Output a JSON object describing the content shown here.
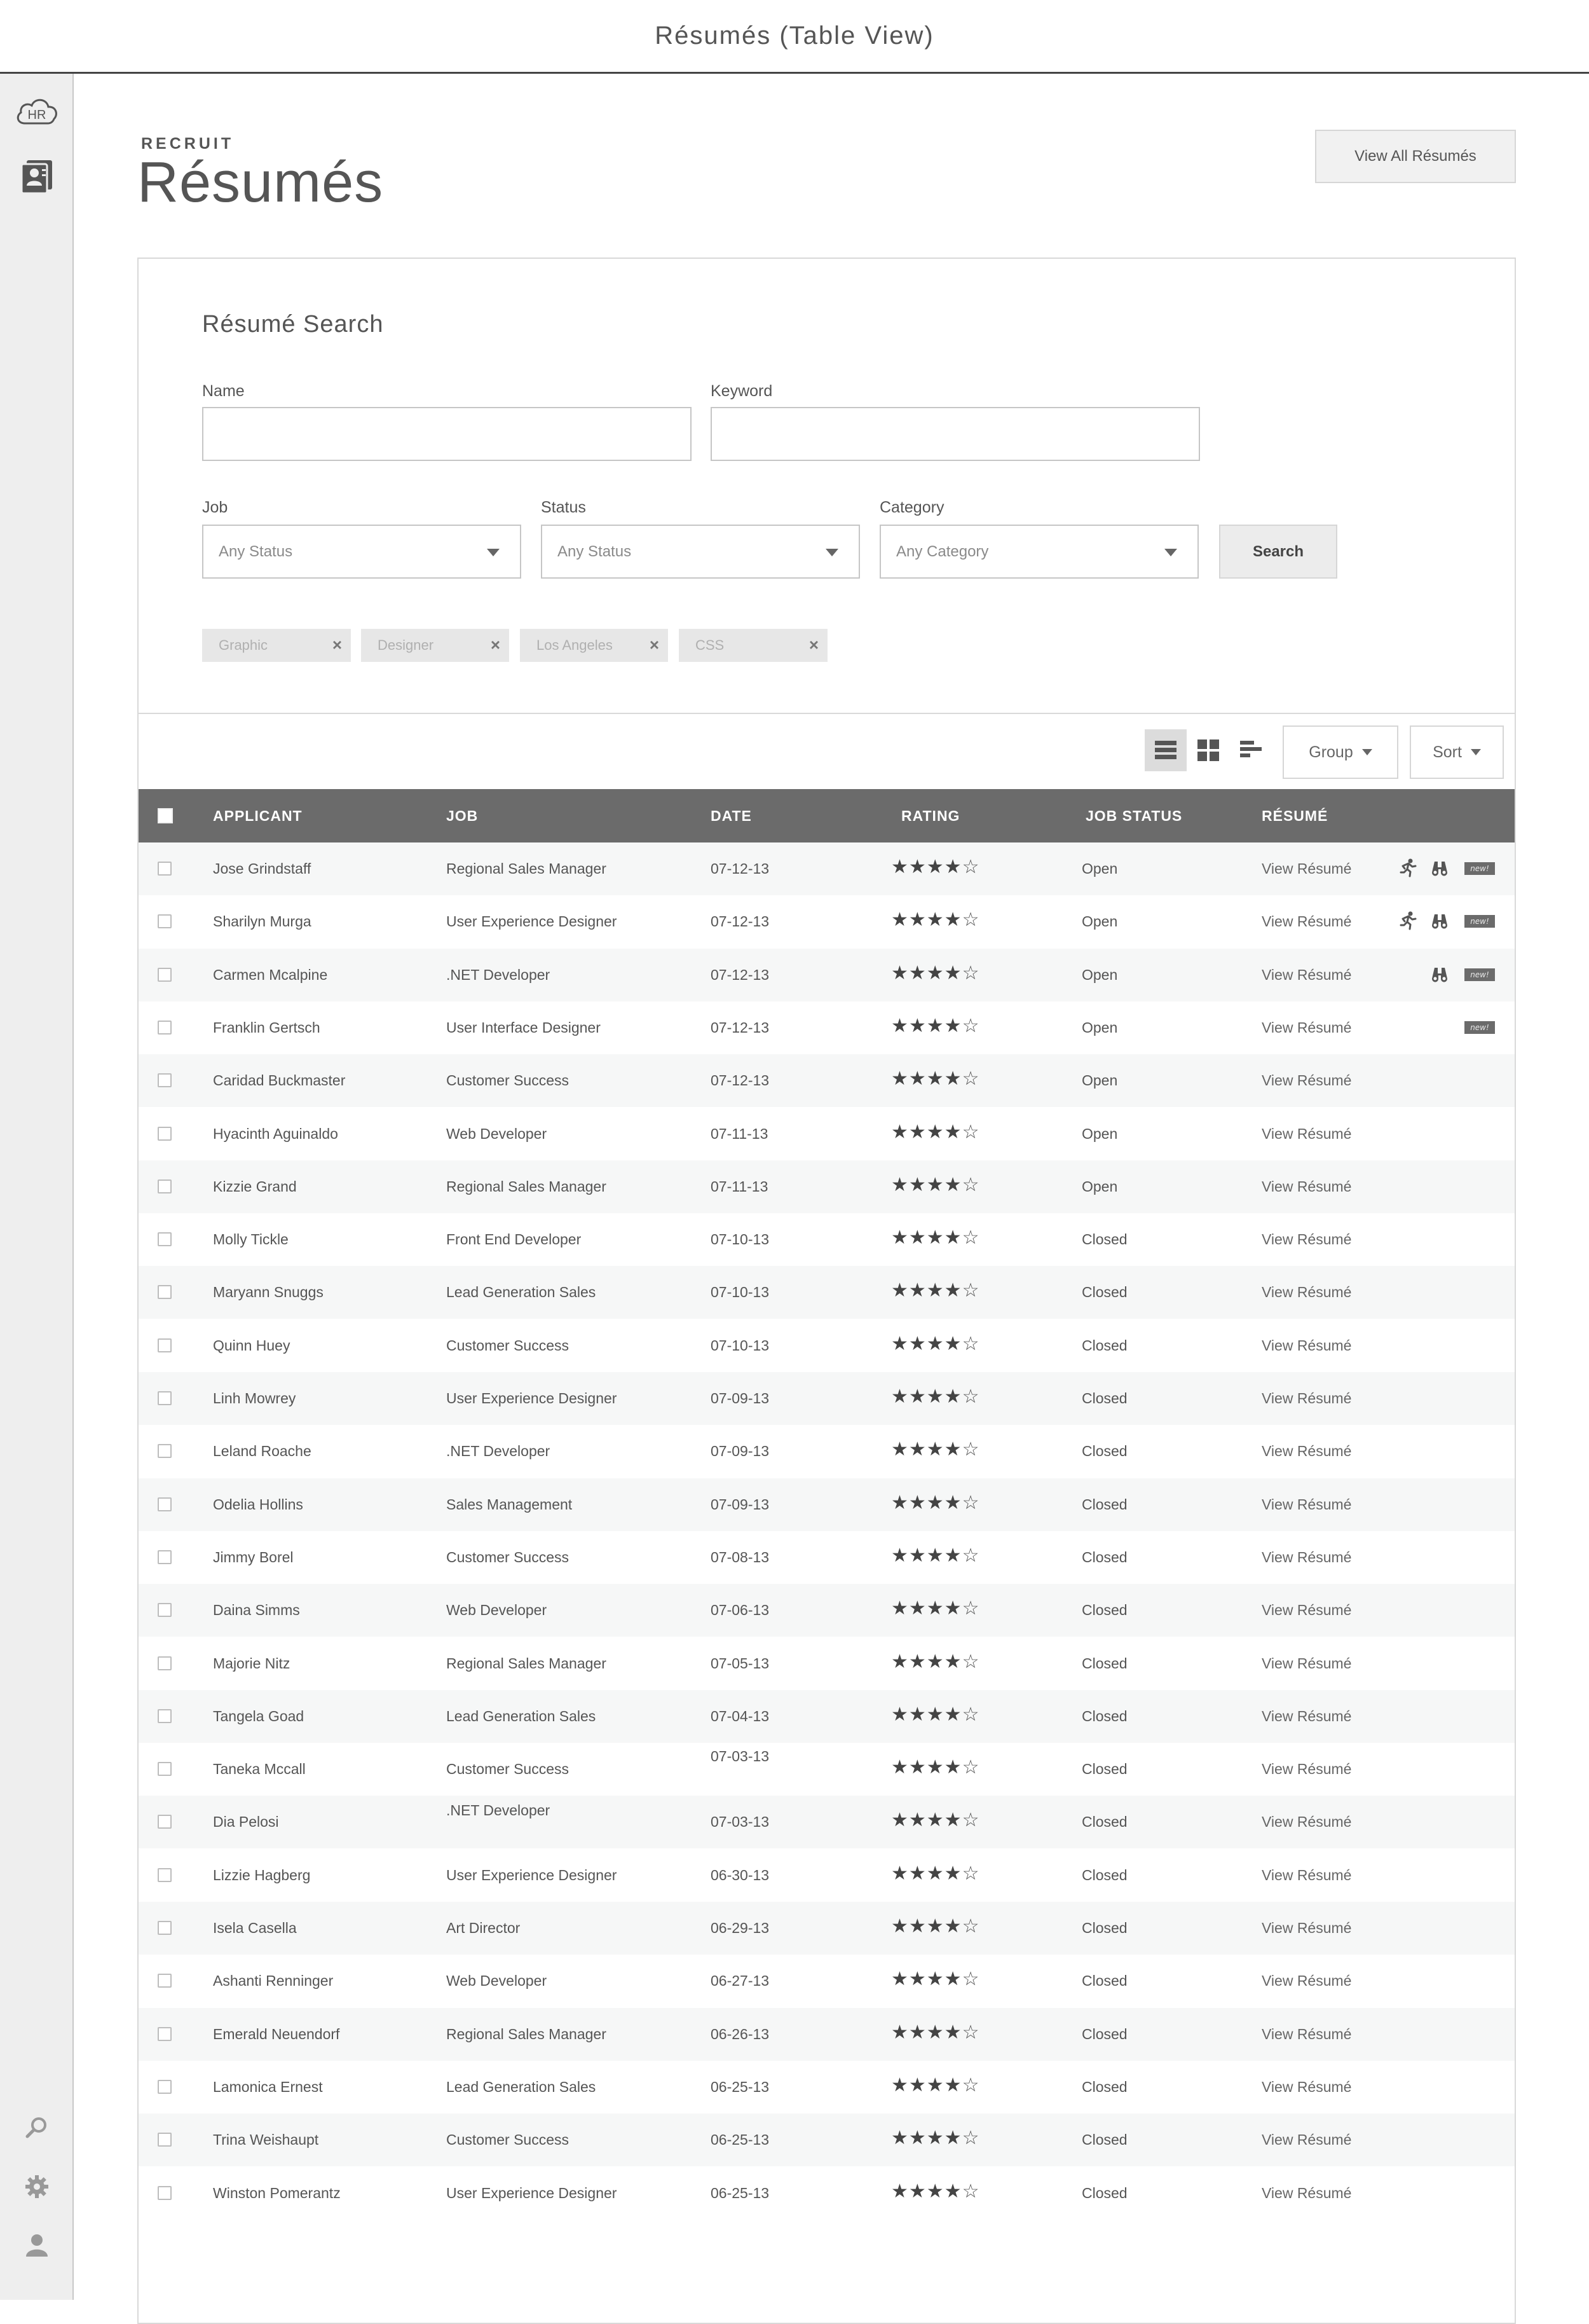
{
  "window": {
    "title": "Résumés (Table View)"
  },
  "sidebar": {
    "items": [
      {
        "icon": "hr-cloud-icon"
      },
      {
        "icon": "resume-contact-icon"
      },
      {
        "icon": "search-icon"
      },
      {
        "icon": "gear-icon"
      },
      {
        "icon": "user-icon"
      }
    ]
  },
  "header": {
    "eyebrow": "RECRUIT",
    "title": "Résumés",
    "view_all_label": "View All Résumés"
  },
  "search": {
    "title": "Résumé Search",
    "name_label": "Name",
    "name_value": "",
    "keyword_label": "Keyword",
    "keyword_value": "",
    "job_label": "Job",
    "job_value": "Any Status",
    "status_label": "Status",
    "status_value": "Any Status",
    "category_label": "Category",
    "category_value": "Any Category",
    "search_button": "Search",
    "chips": [
      "Graphic",
      "Designer",
      "Los Angeles",
      "CSS"
    ]
  },
  "toolbar": {
    "view_icons": [
      "list-view-icon",
      "grid-view-icon",
      "timeline-view-icon"
    ],
    "group_label": "Group",
    "sort_label": "Sort"
  },
  "table": {
    "columns": [
      "APPLICANT",
      "JOB",
      "DATE",
      "RATING",
      "JOB STATUS",
      "RÉSUMÉ"
    ],
    "link_label": "View Résumé",
    "new_label": "new!",
    "rows": [
      {
        "applicant": "Jose Grindstaff",
        "job": "Regional Sales Manager",
        "date": "07-12-13",
        "rating": 4,
        "status": "Open",
        "runner": true,
        "binoculars": true,
        "new": true
      },
      {
        "applicant": "Sharilyn Murga",
        "job": "User Experience Designer",
        "date": "07-12-13",
        "rating": 4,
        "status": "Open",
        "runner": true,
        "binoculars": true,
        "new": true
      },
      {
        "applicant": "Carmen Mcalpine",
        "job": ".NET Developer",
        "date": "07-12-13",
        "rating": 4,
        "status": "Open",
        "runner": false,
        "binoculars": true,
        "new": true
      },
      {
        "applicant": "Franklin Gertsch",
        "job": "User Interface Designer",
        "date": "07-12-13",
        "rating": 4,
        "status": "Open",
        "runner": false,
        "binoculars": false,
        "new": true
      },
      {
        "applicant": "Caridad Buckmaster",
        "job": "Customer Success",
        "date": "07-12-13",
        "rating": 4,
        "status": "Open"
      },
      {
        "applicant": "Hyacinth Aguinaldo",
        "job": "Web Developer",
        "date": "07-11-13",
        "rating": 4,
        "status": "Open"
      },
      {
        "applicant": "Kizzie Grand",
        "job": "Regional Sales Manager",
        "date": "07-11-13",
        "rating": 4,
        "status": "Open"
      },
      {
        "applicant": "Molly Tickle",
        "job": "Front End Developer",
        "date": "07-10-13",
        "rating": 4,
        "status": "Closed"
      },
      {
        "applicant": "Maryann Snuggs",
        "job": "Lead Generation Sales",
        "date": "07-10-13",
        "rating": 4,
        "status": "Closed"
      },
      {
        "applicant": "Quinn Huey",
        "job": "Customer Success",
        "date": "07-10-13",
        "rating": 4,
        "status": "Closed"
      },
      {
        "applicant": "Linh Mowrey",
        "job": "User Experience Designer",
        "date": "07-09-13",
        "rating": 4,
        "status": "Closed"
      },
      {
        "applicant": "Leland Roache",
        "job": ".NET Developer",
        "date": "07-09-13",
        "rating": 4,
        "status": "Closed"
      },
      {
        "applicant": "Odelia Hollins",
        "job": "Sales Management",
        "date": "07-09-13",
        "rating": 4,
        "status": "Closed"
      },
      {
        "applicant": "Jimmy Borel",
        "job": "Customer Success",
        "date": "07-08-13",
        "rating": 4,
        "status": "Closed"
      },
      {
        "applicant": "Daina Simms",
        "job": "Web Developer",
        "date": "07-06-13",
        "rating": 4,
        "status": "Closed"
      },
      {
        "applicant": "Majorie Nitz",
        "job": "Regional Sales Manager",
        "date": "07-05-13",
        "rating": 4,
        "status": "Closed"
      },
      {
        "applicant": "Tangela Goad",
        "job": "Lead Generation Sales",
        "date": "07-04-13",
        "rating": 4,
        "status": "Closed"
      },
      {
        "applicant": "Taneka Mccall",
        "job": "Customer Success",
        "date": "07-03-13",
        "rating": 4,
        "status": "Closed"
      },
      {
        "applicant": "Dia Pelosi",
        "job": ".NET Developer",
        "date": "07-03-13",
        "rating": 4,
        "status": "Closed"
      },
      {
        "applicant": "Lizzie Hagberg",
        "job": "User Experience Designer",
        "date": "06-30-13",
        "rating": 4,
        "status": "Closed"
      },
      {
        "applicant": "Isela Casella",
        "job": "Art Director",
        "date": "06-29-13",
        "rating": 4,
        "status": "Closed"
      },
      {
        "applicant": "Ashanti Renninger",
        "job": "Web Developer",
        "date": "06-27-13",
        "rating": 4,
        "status": "Closed"
      },
      {
        "applicant": "Emerald Neuendorf",
        "job": "Regional Sales Manager",
        "date": "06-26-13",
        "rating": 4,
        "status": "Closed"
      },
      {
        "applicant": "Lamonica Ernest",
        "job": "Lead Generation Sales",
        "date": "06-25-13",
        "rating": 4,
        "status": "Closed"
      },
      {
        "applicant": "Trina Weishaupt",
        "job": "Customer Success",
        "date": "06-25-13",
        "rating": 4,
        "status": "Closed"
      },
      {
        "applicant": "Winston Pomerantz",
        "job": "User Experience Designer",
        "date": "06-25-13",
        "rating": 4,
        "status": "Closed"
      }
    ]
  },
  "colors": {
    "header_bg": "#6b6b6b",
    "row_alt": "#f6f7f7",
    "sidebar_bg": "#eeeeee"
  }
}
